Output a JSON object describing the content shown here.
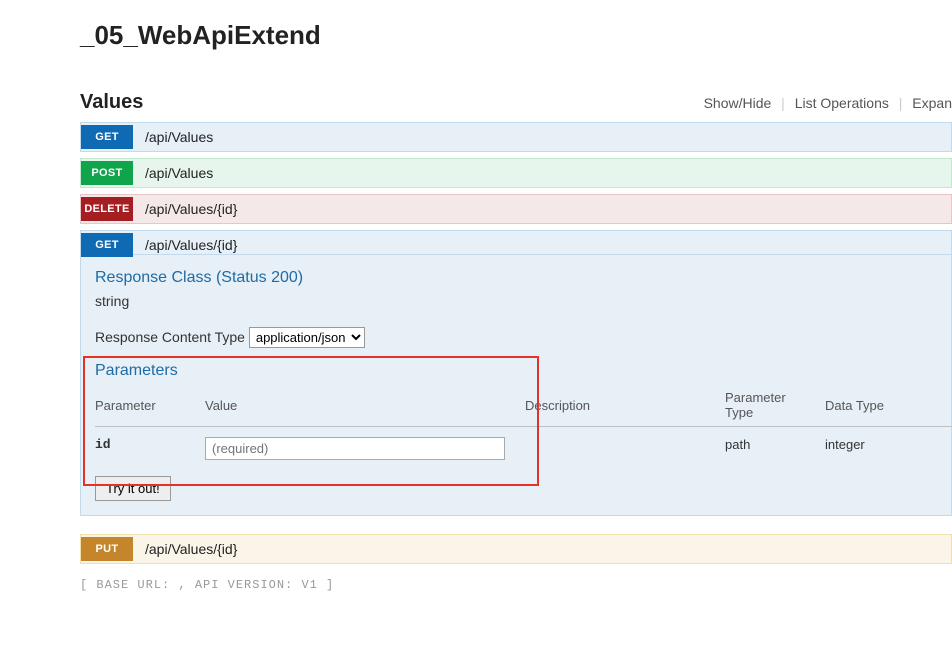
{
  "title": "_05_WebApiExtend",
  "section": {
    "name": "Values",
    "actions": {
      "showhide": "Show/Hide",
      "list": "List Operations",
      "expand": "Expan"
    }
  },
  "ops": [
    {
      "method": "GET",
      "path": "/api/Values",
      "cls": "get"
    },
    {
      "method": "POST",
      "path": "/api/Values",
      "cls": "post"
    },
    {
      "method": "DELETE",
      "path": "/api/Values/{id}",
      "cls": "delete"
    },
    {
      "method": "GET",
      "path": "/api/Values/{id}",
      "cls": "get",
      "expanded": true
    },
    {
      "method": "PUT",
      "path": "/api/Values/{id}",
      "cls": "put"
    }
  ],
  "expanded": {
    "response_class_label": "Response Class (Status 200)",
    "response_type": "string",
    "content_type_label": "Response Content Type",
    "content_type_value": "application/json",
    "parameters_label": "Parameters",
    "columns": {
      "parameter": "Parameter",
      "value": "Value",
      "description": "Description",
      "param_type": "Parameter Type",
      "data_type": "Data Type"
    },
    "row": {
      "name": "id",
      "placeholder": "(required)",
      "description": "",
      "param_type": "path",
      "data_type": "integer"
    },
    "try_label": "Try it out!"
  },
  "footer": {
    "base_url_label": "base url:",
    "base_url": "",
    "api_version_label": "api version:",
    "api_version": "v1"
  }
}
